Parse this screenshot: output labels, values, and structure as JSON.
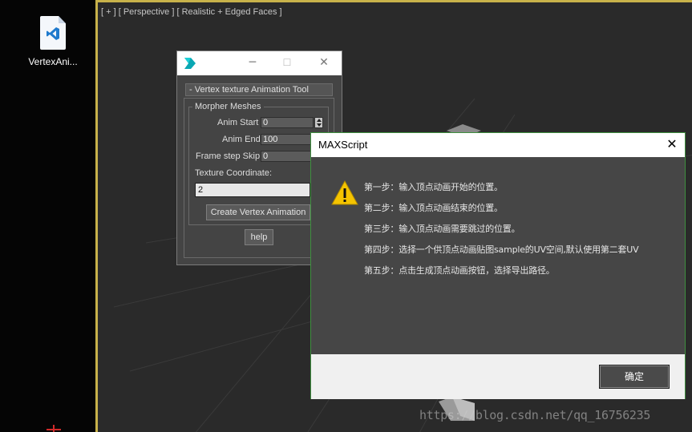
{
  "desktop": {
    "icon_label": "VertexAni...",
    "icon": "vscode-file-icon"
  },
  "viewport": {
    "label": "[ + ] [ Perspective ] [ Realistic + Edged Faces ]",
    "border_color": "#c8b24a"
  },
  "rollout": {
    "app_icon": "3dsmax-icon",
    "group_header": "-   Vertex texture Animation Tool",
    "legend": "Morpher Meshes",
    "anim_start_label": "Anim Start",
    "anim_start_value": "0",
    "anim_end_label": "Anim End",
    "anim_end_value": "100",
    "frame_step_label": "Frame step Skip",
    "frame_step_value": "0",
    "texture_coord_label": "Texture Coordinate:",
    "texture_coord_value": "2",
    "create_button": "Create Vertex Animation",
    "help_button": "help"
  },
  "dialog": {
    "title": "MAXScript",
    "icon": "warning-icon",
    "lines": [
      "第一步：输入顶点动画开始的位置。",
      "第二步：输入顶点动画结束的位置。",
      "第三步：输入顶点动画需要跳过的位置。",
      "第四步：选择一个供顶点动画贴图sample的UV空间,默认使用第二套UV",
      "第五步：点击生成顶点动画按钮，选择导出路径。"
    ],
    "ok_button": "确定"
  },
  "watermark": "https://blog.csdn.net/qq_16756235"
}
